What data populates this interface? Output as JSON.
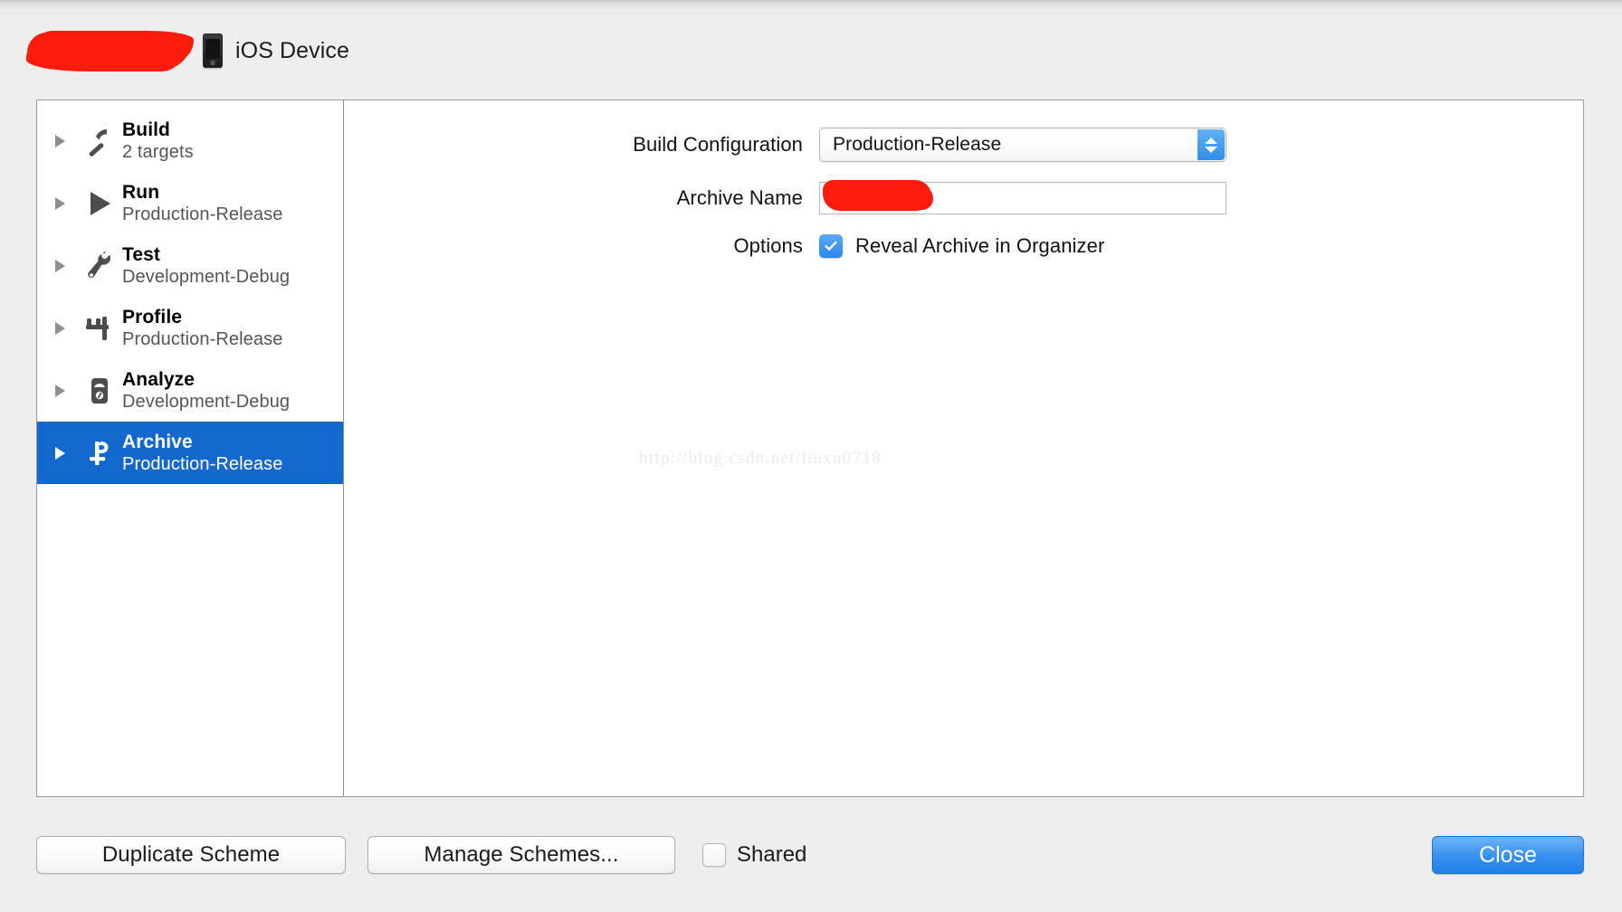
{
  "window": {
    "scheme_name_redacted": true,
    "device_label": "iOS Device",
    "device_icon": "iphone-icon"
  },
  "sidebar": {
    "items": [
      {
        "title": "Build",
        "subtitle": "2 targets",
        "icon": "hammer-icon",
        "selected": false
      },
      {
        "title": "Run",
        "subtitle": "Production-Release",
        "icon": "play-icon",
        "selected": false
      },
      {
        "title": "Test",
        "subtitle": "Development-Debug",
        "icon": "wrench-icon",
        "selected": false
      },
      {
        "title": "Profile",
        "subtitle": "Production-Release",
        "icon": "caliper-icon",
        "selected": false
      },
      {
        "title": "Analyze",
        "subtitle": "Development-Debug",
        "icon": "multimeter-icon",
        "selected": false
      },
      {
        "title": "Archive",
        "subtitle": "Production-Release",
        "icon": "archive-icon",
        "selected": true
      }
    ]
  },
  "main": {
    "build_configuration": {
      "label": "Build Configuration",
      "value": "Production-Release",
      "options": [
        "Production-Release"
      ]
    },
    "archive_name": {
      "label": "Archive Name",
      "value": "",
      "placeholder": "",
      "redacted": true
    },
    "options": {
      "label": "Options",
      "reveal_archive_label": "Reveal Archive in Organizer",
      "reveal_archive_checked": true
    },
    "watermark": "http://blog.csdn.net/liuxu0718"
  },
  "footer": {
    "duplicate_scheme_label": "Duplicate Scheme",
    "manage_schemes_label": "Manage Schemes...",
    "shared_label": "Shared",
    "shared_checked": false,
    "close_label": "Close"
  },
  "colors": {
    "selection_blue": "#1268cd",
    "accent_blue": "#2d86ec",
    "redaction_red": "#fd1b0c",
    "window_bg": "#eeeeee"
  }
}
